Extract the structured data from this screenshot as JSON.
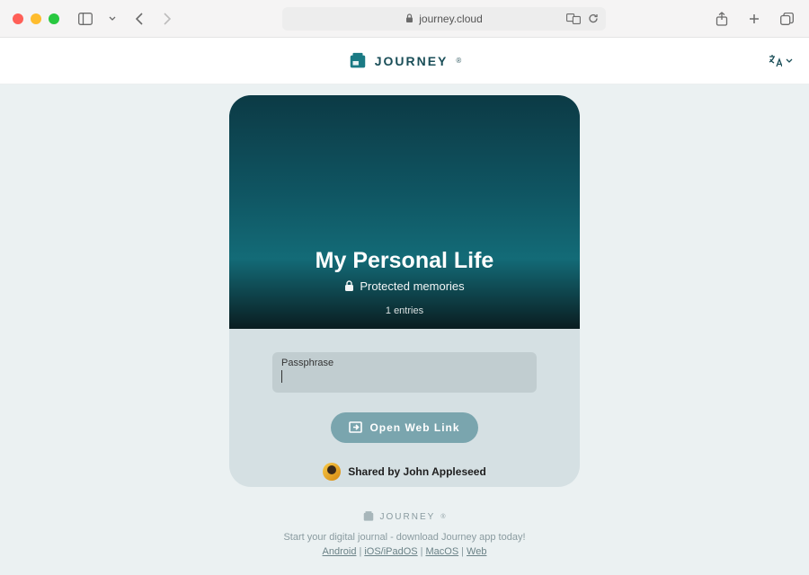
{
  "browser": {
    "url": "journey.cloud"
  },
  "header": {
    "brand": "JOURNEY",
    "brand_mark": "®"
  },
  "card": {
    "title": "My Personal Life",
    "subtitle": "Protected memories",
    "entries_text": "1 entries",
    "passphrase_label": "Passphrase",
    "passphrase_value": "",
    "open_button": "Open Web Link",
    "shared_by": "Shared by John Appleseed"
  },
  "footer": {
    "brand": "JOURNEY",
    "brand_mark": "®",
    "tagline": "Start your digital journal - download Journey app today!",
    "links": {
      "android": "Android",
      "ios": "iOS/iPadOS",
      "macos": "MacOS",
      "web": "Web"
    }
  }
}
